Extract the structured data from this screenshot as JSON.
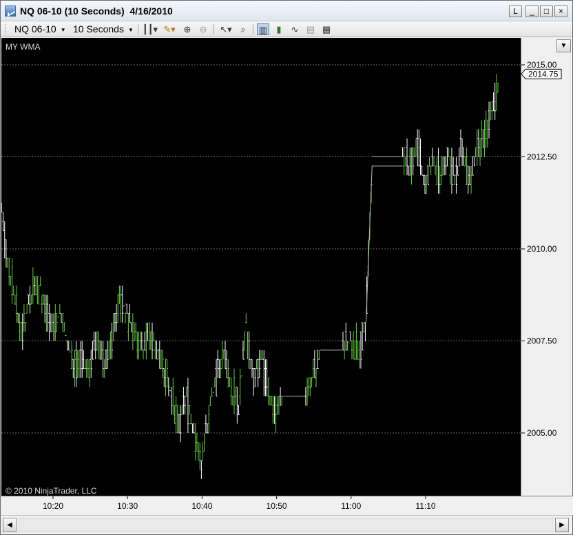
{
  "window": {
    "title": "NQ 06-10 (10 Seconds)  4/16/2010",
    "buttons": {
      "link": "L",
      "minimize": "_",
      "maximize": "□",
      "close": "×"
    }
  },
  "toolbar": {
    "instrument": "NQ 06-10",
    "interval": "10 Seconds",
    "icons": [
      "bar-type-icon",
      "drawing-pencil-icon",
      "zoom-in-icon",
      "zoom-out-icon",
      "cursor-icon",
      "magnifier-icon",
      "chart-trader-icon",
      "candlestick-icon",
      "line-chart-icon",
      "data-box-icon",
      "properties-icon"
    ]
  },
  "chart": {
    "indicator_label": "MY WMA",
    "copyright": "© 2010 NinjaTrader, LLC",
    "current_price_label": "2014.75"
  },
  "chart_data": {
    "type": "ohlc",
    "instrument": "NQ 06-10",
    "interval": "10 Seconds",
    "date": "4/16/2010",
    "y_ticks": [
      "2015.00",
      "2012.50",
      "2010.00",
      "2007.50",
      "2005.00"
    ],
    "x_ticks": [
      "10:20",
      "10:30",
      "10:40",
      "10:50",
      "11:00",
      "11:10"
    ],
    "ylim": [
      2003.25,
      2015.5
    ],
    "last_price": 2014.75,
    "up_color": "#66cc44",
    "down_color": "#ffffff",
    "grid": true,
    "price_path": [
      [
        "10:13",
        2011.25
      ],
      [
        "10:14",
        2009.75
      ],
      [
        "10:15",
        2008.5
      ],
      [
        "10:16",
        2007.75
      ],
      [
        "10:17",
        2008.75
      ],
      [
        "10:18",
        2009.0
      ],
      [
        "10:19",
        2008.5
      ],
      [
        "10:20",
        2007.75
      ],
      [
        "10:21",
        2008.25
      ],
      [
        "10:22",
        2007.5
      ],
      [
        "10:23",
        2006.75
      ],
      [
        "10:24",
        2007.0
      ],
      [
        "10:25",
        2006.75
      ],
      [
        "10:26",
        2007.5
      ],
      [
        "10:27",
        2006.75
      ],
      [
        "10:28",
        2007.5
      ],
      [
        "10:29",
        2008.75
      ],
      [
        "10:30",
        2008.25
      ],
      [
        "10:31",
        2007.75
      ],
      [
        "10:32",
        2007.25
      ],
      [
        "10:33",
        2007.75
      ],
      [
        "10:34",
        2007.25
      ],
      [
        "10:35",
        2006.75
      ],
      [
        "10:36",
        2006.0
      ],
      [
        "10:37",
        2005.25
      ],
      [
        "10:38",
        2006.0
      ],
      [
        "10:39",
        2005.0
      ],
      [
        "10:40",
        2004.25
      ],
      [
        "10:41",
        2005.5
      ],
      [
        "10:42",
        2006.5
      ],
      [
        "10:43",
        2007.25
      ],
      [
        "10:44",
        2006.25
      ],
      [
        "10:45",
        2005.75
      ],
      [
        "10:46",
        2007.75
      ],
      [
        "10:47",
        2006.5
      ],
      [
        "10:48",
        2007.0
      ],
      [
        "10:49",
        2006.25
      ],
      [
        "10:50",
        2005.5
      ],
      [
        "10:51",
        2006.0
      ],
      [
        "10:52",
        2006.0
      ],
      [
        "10:53",
        2006.0
      ],
      [
        "10:54",
        2006.0
      ],
      [
        "10:55",
        2006.5
      ],
      [
        "10:56",
        2007.25
      ],
      [
        "10:57",
        2007.25
      ],
      [
        "10:58",
        2007.25
      ],
      [
        "10:59",
        2007.25
      ],
      [
        "11:00",
        2007.5
      ],
      [
        "11:01",
        2007.25
      ],
      [
        "11:02",
        2007.75
      ],
      [
        "11:03",
        2012.5
      ],
      [
        "11:04",
        2012.5
      ],
      [
        "11:05",
        2012.5
      ],
      [
        "11:06",
        2012.5
      ],
      [
        "11:07",
        2012.5
      ],
      [
        "11:08",
        2012.25
      ],
      [
        "11:09",
        2012.75
      ],
      [
        "11:10",
        2011.75
      ],
      [
        "11:11",
        2012.5
      ],
      [
        "11:12",
        2012.0
      ],
      [
        "11:13",
        2012.5
      ],
      [
        "11:14",
        2012.0
      ],
      [
        "11:15",
        2012.75
      ],
      [
        "11:16",
        2011.75
      ],
      [
        "11:17",
        2012.75
      ],
      [
        "11:18",
        2013.0
      ],
      [
        "11:19",
        2013.75
      ],
      [
        "11:20",
        2014.75
      ]
    ]
  }
}
